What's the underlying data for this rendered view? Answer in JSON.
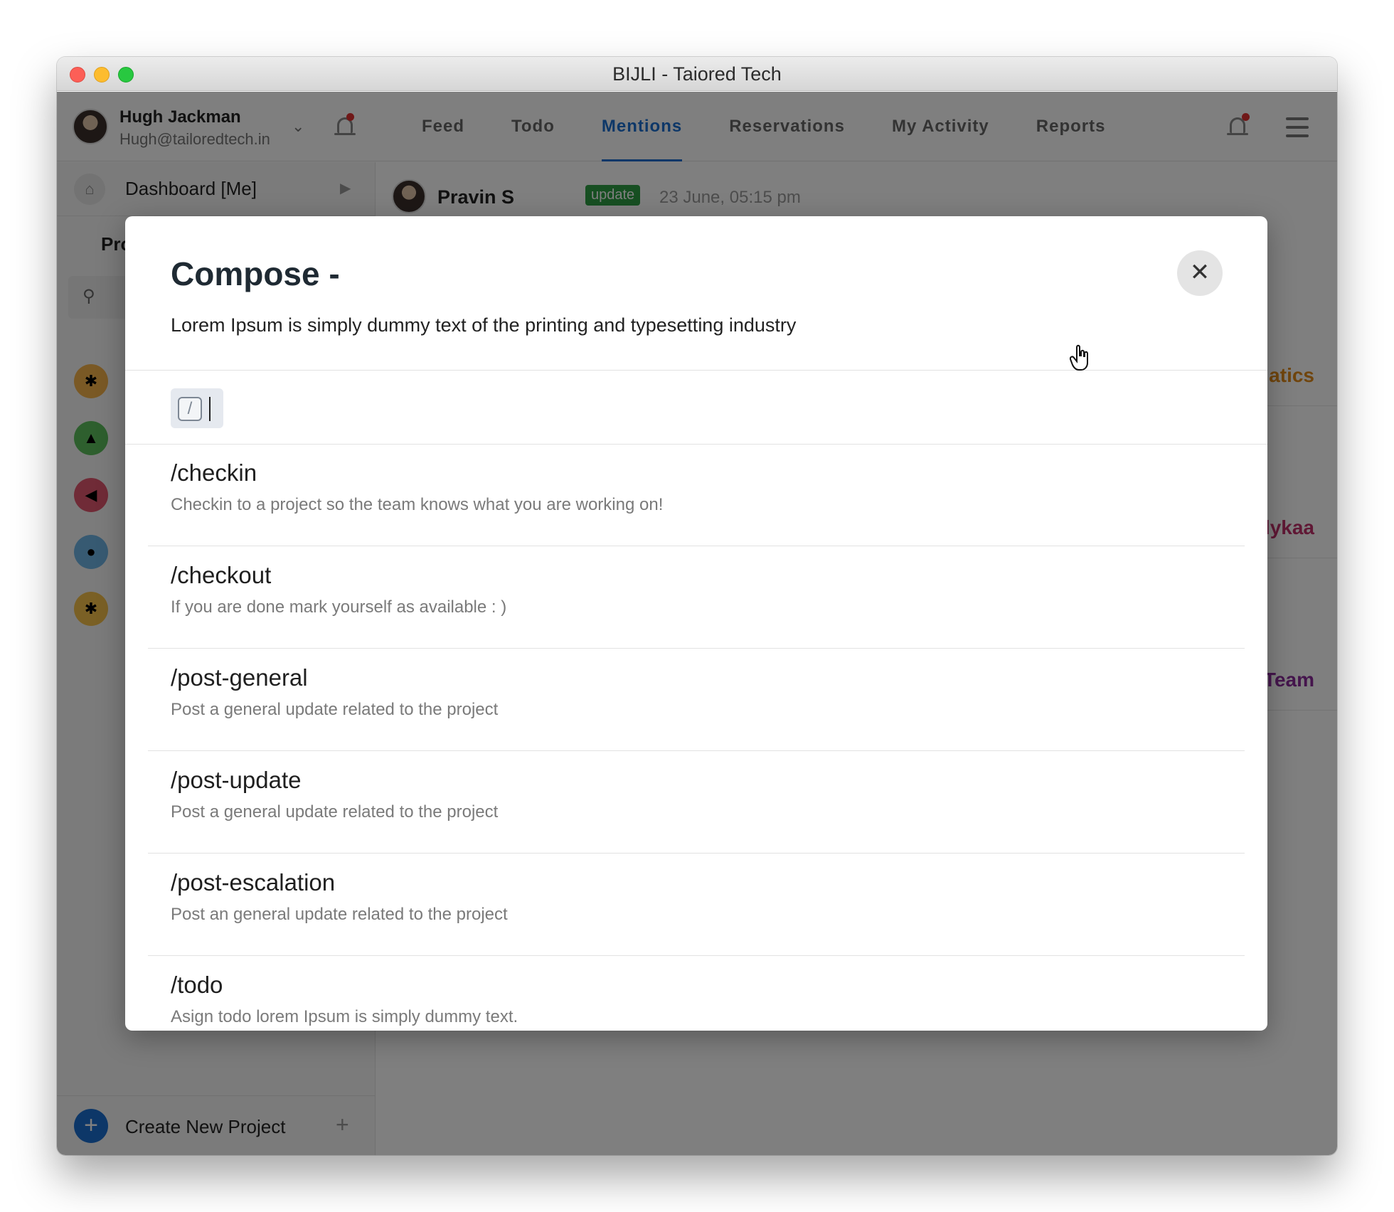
{
  "window": {
    "title": "BIJLI - Taiored Tech"
  },
  "user": {
    "name": "Hugh Jackman",
    "email": "Hugh@tailoredtech.in"
  },
  "nav": {
    "tabs": [
      {
        "label": "Feed"
      },
      {
        "label": "Todo"
      },
      {
        "label": "Mentions",
        "active": true
      },
      {
        "label": "Reservations"
      },
      {
        "label": "My Activity"
      },
      {
        "label": "Reports"
      }
    ]
  },
  "sidebar": {
    "dashboard_label": "Dashboard [Me]",
    "projects_heading": "Pro",
    "create_project_label": "Create New Project",
    "project_colors": [
      "#f4b24a",
      "#5cbf5c",
      "#e0566e",
      "#6fb5e4",
      "#f4c04a"
    ]
  },
  "feed": {
    "post_author": "Pravin S",
    "post_badge": "update",
    "post_time": "23 June, 05:15 pm",
    "peek_labels": [
      "atics",
      "lykaa",
      "Team"
    ],
    "peek_colors": [
      "#e08a1a",
      "#c0306a",
      "#8a2a9a"
    ]
  },
  "modal": {
    "title": "Compose -",
    "subtitle": "Lorem Ipsum is simply dummy text of the printing and typesetting industry",
    "close_icon": "close-icon",
    "input_icon": "slash-command-icon",
    "commands": [
      {
        "name": "/checkin",
        "description": "Checkin to a project so the team knows what you are working on!"
      },
      {
        "name": "/checkout",
        "description": "If you are done mark yourself as available : )"
      },
      {
        "name": "/post-general",
        "description": "Post a general update related to the project"
      },
      {
        "name": "/post-update",
        "description": "Post a general update related to the project"
      },
      {
        "name": "/post-escalation",
        "description": "Post an general update related to the project"
      },
      {
        "name": "/todo",
        "description": "Asign todo lorem Ipsum is simply dummy text."
      }
    ]
  },
  "colors": {
    "accent": "#1b6fd1",
    "badge_green": "#2e9e44",
    "notification_red": "#e03131"
  }
}
